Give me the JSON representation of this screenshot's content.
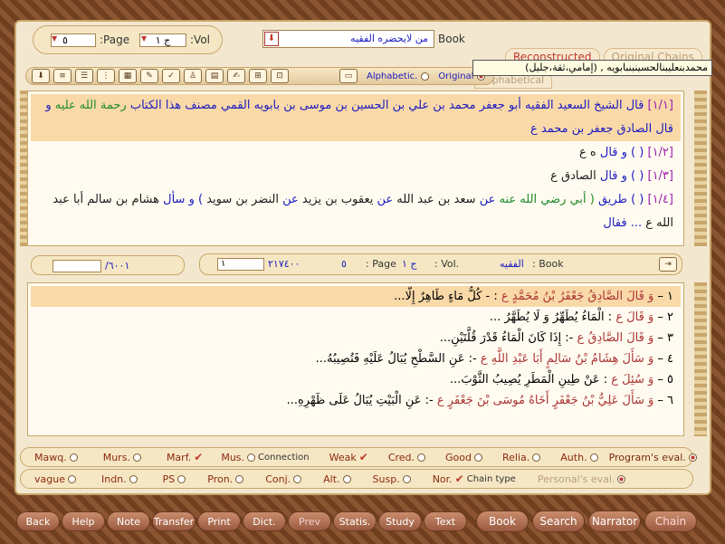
{
  "header": {
    "page_label": ":Page",
    "vol_label": ":Vol",
    "book_label": "Book",
    "page_value": "٥",
    "vol_value": "ج ١",
    "book_value": "من لايحضره الفقيه"
  },
  "tabs": [
    "Reconstructed",
    "Original Chains",
    "Alphabetical"
  ],
  "toolbar": {
    "alphabetic_label": "Alphabetic.",
    "original_label": "Original",
    "tooltip": "محمدبنعليبنالحسينبنبابويه , (إمامي،ثقة،جليل)"
  },
  "main_text": {
    "line1_ref": "[١/١]",
    "line1_a": "قال الشيخ السعيد الفقيه أبو جعفر محمد بن علي بن الحسين بن موسى بن بابويه القمي مصنف هذا الكتاب",
    "line1_b": "رحمة الله عليه",
    "line1_c": "و",
    "line2": "قال الصادق جعفر بن محمد ع",
    "line3_ref": "[١/٢]",
    "line3_a": "( ) و قال",
    "line3_b": "ه ع",
    "line4_ref": "[١/٣]",
    "line4_a": "( ) و قال",
    "line4_b": "الصادق ع",
    "line5_ref": "[١/٤]",
    "line5_a": "( ) طريق",
    "line5_b": "( أبي رضي الله عنه",
    "line5_c": "عن",
    "line5_d": "سعد بن عبد الله",
    "line5_e": "عن",
    "line5_f": "يعقوب بن يزيد",
    "line5_g": "عن",
    "line5_h": "النضر بن سويد",
    "line5_i": ") و سأل",
    "line5_j": "هشام بن سالم أبا عبد",
    "line6": "الله ع",
    "line6_b": "... فقال"
  },
  "status_left": {
    "count": "/٦٠٠١",
    "input": ""
  },
  "status_right": {
    "input": "١",
    "num1": "٢١٧٤٠٠",
    "num2": "٥",
    "page_label": ": Page",
    "page_val": "ج ١",
    "vol_label": ": Vol.",
    "book_val": "الفقيه",
    "book_label": ": Book"
  },
  "verses": [
    {
      "num": "١",
      "a": "وَ قَالَ الصَّادِقُ جَعْفَرُ بْنُ مُحَمَّدٍ ع",
      "b": ": - كُلُّ مَاءٍ طَاهِرٌ إِلَّا..."
    },
    {
      "num": "٢",
      "a": "وَ قَالَ ع",
      "b": ": الْمَاءُ يُطَهِّرُ وَ لَا يُطَهَّرُ ..."
    },
    {
      "num": "٣",
      "a": "وَ قَالَ الصَّادِقُ ع",
      "b": "-: إِذَا كَانَ الْمَاءُ قَدْرَ قُلَّتَيْنِ..."
    },
    {
      "num": "٤",
      "a": "وَ سَأَلَ هِشَامُ بْنُ سَالِمٍ أَبَا عَبْدِ اللَّهِ ع",
      "b": "-: عَنِ السَّطْحِ يُبَالُ عَلَيْهِ فَتُصِيبُهُ..."
    },
    {
      "num": "٥",
      "a": "وَ سُئِلَ ع",
      "b": ": عَنْ طِينِ الْمَطَرِ يُصِيبُ الثَّوْبَ..."
    },
    {
      "num": "٦",
      "a": "وَ سَأَلَ عَلِيُّ بْنُ جَعْفَرٍ أَخَاهُ مُوسَى بْنَ جَعْفَرٍ ع",
      "b": "-: عَنِ الْبَيْتِ يُبَالُ عَلَى ظَهْرِهِ..."
    }
  ],
  "eval_row1": {
    "items": [
      "Mawq.",
      "Murs.",
      "Marf.",
      "Mus.",
      "Connection",
      "Weak",
      "Cred.",
      "Good",
      "Relia.",
      "Auth."
    ],
    "label": "Program's eval."
  },
  "eval_row2": {
    "items": [
      "vague",
      "Indn.",
      "PS",
      "Pron.",
      "Conj.",
      "Alt.",
      "Susp.",
      "Nor.",
      "Chain type"
    ],
    "label": "Personal's eval."
  },
  "bottom": [
    "Back",
    "Help",
    "Note",
    "Transfer",
    "Print",
    "Dict.",
    "Prev",
    "Statis.",
    "Study",
    "Text"
  ],
  "bottom_right": [
    "Book",
    "Search",
    "Narrator",
    "Chain"
  ],
  "colors": {
    "accent": "#c0392b",
    "highlight": "#f9d9a8",
    "frame": "#7d4b28"
  }
}
